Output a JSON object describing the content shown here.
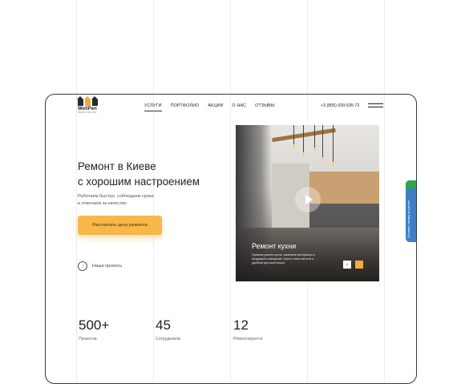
{
  "logo": {
    "name": "WellPen",
    "subtitle": "РЕМОНТ КВАРТИР"
  },
  "nav": {
    "items": [
      "УСЛУГИ",
      "ПОРТФОЛИО",
      "АКЦИИ",
      "О НАС",
      "ОТЗЫВЫ"
    ],
    "active": "УСЛУГИ"
  },
  "header": {
    "phone": "+3 (805) 039-535-72"
  },
  "hero": {
    "title_line1": "Ремонт в Киеве",
    "title_line2": "с хорошим настроением",
    "subtitle_line1": "Работаем быстро, соблюдаем сроки",
    "subtitle_line2": "и отвечаем за качество",
    "cta_label": "Рассчитать цену ремонта",
    "projects_link": "Наши проекты"
  },
  "slide": {
    "title": "Ремонт кухни",
    "description": "Провели ремонт кухни, заменили материалы и продумали освещение. Кухня стала светлой и удобной для всей семьи."
  },
  "stats": [
    {
      "value": "500+",
      "label": "Проектов"
    },
    {
      "value": "45",
      "label": "Сотрудников"
    },
    {
      "value": "12",
      "label": "Ремонтируется"
    }
  ],
  "side_tab": {
    "label": "Оставить заявку на расчёт"
  },
  "colors": {
    "accent": "#f7b849",
    "side_tab": "#3d7fc7",
    "side_tab_top": "#2ea84b"
  }
}
